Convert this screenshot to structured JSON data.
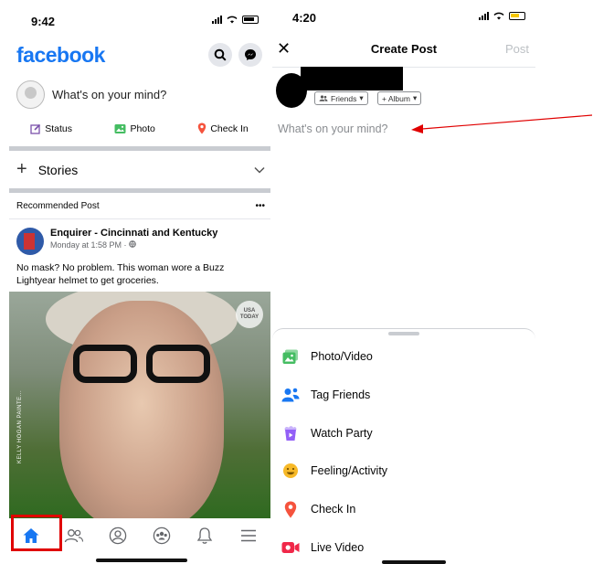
{
  "left_screen": {
    "status": {
      "time": "9:42"
    },
    "brand": "facebook",
    "composer_placeholder": "What's on your mind?",
    "actions": [
      {
        "label": "Status",
        "icon": "edit-icon",
        "color": "#7b52ab"
      },
      {
        "label": "Photo",
        "icon": "photo-icon",
        "color": "#45bd62"
      },
      {
        "label": "Check In",
        "icon": "location-pin-icon",
        "color": "#f5533d"
      }
    ],
    "stories_label": "Stories",
    "recommended_label": "Recommended Post",
    "more_label": "•••",
    "post": {
      "page_name": "Enquirer - Cincinnati and Kentucky",
      "time": "Monday at 1:58 PM · ",
      "text": "No mask? No problem. This woman wore a Buzz Lightyear helmet to get groceries.",
      "photo_badge": "USA TODAY",
      "photo_credit": "KELLY HOGAN PAINTE..."
    },
    "tabs": [
      "home-icon",
      "friends-icon",
      "profile-icon",
      "groups-icon",
      "bell-icon",
      "menu-icon"
    ],
    "accent": "#1877f2"
  },
  "right_screen": {
    "status": {
      "time": "4:20"
    },
    "header": {
      "close": "✕",
      "title": "Create Post",
      "post": "Post"
    },
    "audience_pills": [
      {
        "label": "Friends",
        "icon": "friends-icon"
      },
      {
        "label": "+ Album",
        "icon": ""
      }
    ],
    "placeholder": "What's on your mind?",
    "options": [
      {
        "label": "Photo/Video",
        "icon": "photo-icon",
        "color": "#45bd62"
      },
      {
        "label": "Tag Friends",
        "icon": "tag-friends-icon",
        "color": "#1877f2"
      },
      {
        "label": "Watch Party",
        "icon": "watch-party-icon",
        "color": "#9360f7"
      },
      {
        "label": "Feeling/Activity",
        "icon": "smiley-icon",
        "color": "#f7b928"
      },
      {
        "label": "Check In",
        "icon": "location-pin-icon",
        "color": "#f5533d"
      },
      {
        "label": "Live Video",
        "icon": "live-video-icon",
        "color": "#f02849"
      }
    ]
  },
  "annotation": {
    "arrow_color": "#e00000",
    "highlight_color": "#e00000"
  }
}
